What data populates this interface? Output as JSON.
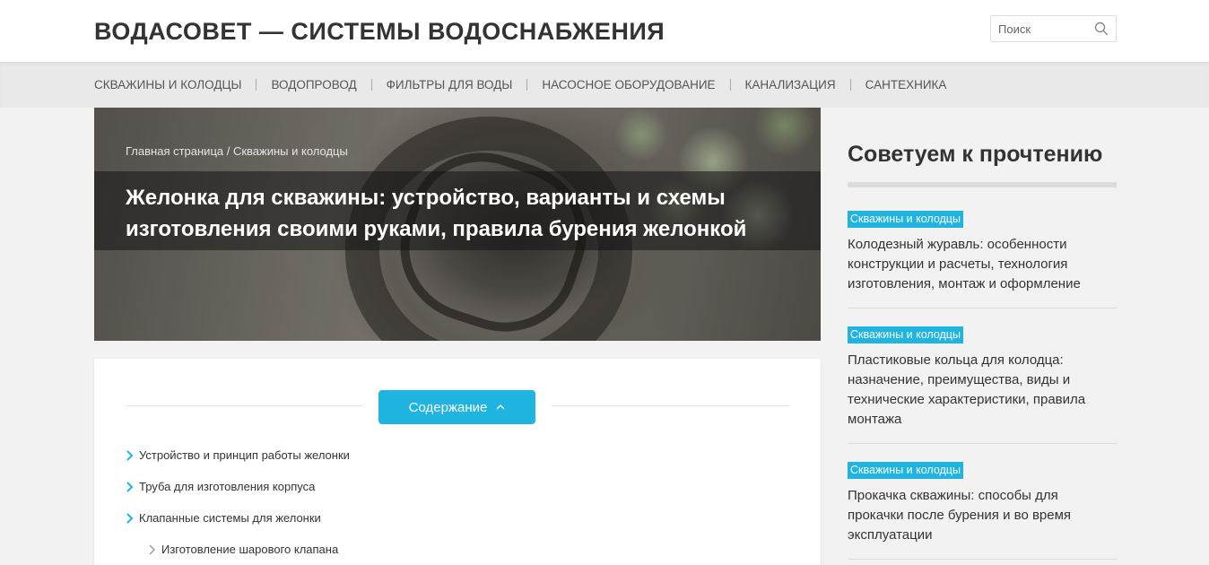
{
  "header": {
    "site_title": "ВОДАСОВЕТ — СИСТЕМЫ ВОДОСНАБЖЕНИЯ",
    "search_placeholder": "Поиск"
  },
  "nav": {
    "items": [
      "СКВАЖИНЫ И КОЛОДЦЫ",
      "ВОДОПРОВОД",
      "ФИЛЬТРЫ ДЛЯ ВОДЫ",
      "НАСОСНОЕ ОБОРУДОВАНИЕ",
      "КАНАЛИЗАЦИЯ",
      "САНТЕХНИКА"
    ]
  },
  "hero": {
    "breadcrumb_home": "Главная страница",
    "breadcrumb_sep": " / ",
    "breadcrumb_section": "Скважины и колодцы",
    "title": "Желонка для скважины: устройство, варианты и схемы изготовления своими руками, правила бурения желонкой"
  },
  "toc": {
    "button_label": "Содержание",
    "items": [
      "Устройство и принцип работы желонки",
      "Труба для изготовления корпуса",
      "Клапанные системы для желонки",
      "Изготовление шарового клапана"
    ]
  },
  "sidebar": {
    "title": "Советуем к прочтению",
    "posts": [
      {
        "tag": "Скважины и колодцы",
        "title": "Колодезный журавль: особенности конструкции и расчеты, технология изготовления, монтаж и оформление"
      },
      {
        "tag": "Скважины и колодцы",
        "title": "Пластиковые кольца для колодца: назначение, преимущества, виды и технические характеристики, правила монтажа"
      },
      {
        "tag": "Скважины и колодцы",
        "title": "Прокачка скважины: способы для прокачки после бурения и во время эксплуатации"
      }
    ]
  },
  "colors": {
    "accent": "#1fb5e0",
    "header_bg": "#ffffff",
    "nav_bg": "#e9e9e9",
    "page_bg": "#f2f2f2",
    "text": "#333333"
  }
}
